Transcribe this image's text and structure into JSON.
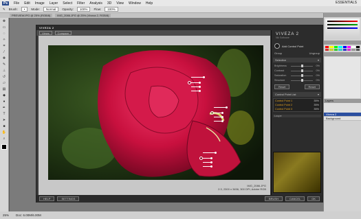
{
  "menubar": {
    "app_badge": "Ps",
    "items": [
      "File",
      "Edit",
      "Image",
      "Layer",
      "Select",
      "Filter",
      "Analysis",
      "3D",
      "View",
      "Window",
      "Help"
    ],
    "workspace": "ESSENTIALS"
  },
  "options_bar": {
    "brush_label": "Brush:",
    "mode_label": "Mode:",
    "mode_value": "Normal",
    "opacity_label": "Opacity:",
    "opacity_value": "100%",
    "flow_label": "Flow:",
    "flow_value": "100%"
  },
  "doc_tabs": [
    "PREVIEW.IPG @ 25% (RGB/8)",
    "IMG_2086.JPG @ 25% (Viveza 2, RGB/8)"
  ],
  "status": {
    "zoom": "25%",
    "doc": "Doc: 6.00M/6.00M"
  },
  "panels": {
    "layers_title": "Layers",
    "layers": [
      "Viveza 2",
      "Background"
    ]
  },
  "viveza": {
    "title_badge": "VIVEZA 2",
    "toolbar": {
      "view_button": "Views",
      "compare_button": "Compare"
    },
    "logo": "VIVEZA 2",
    "logo_sub": "Nik Software",
    "add_control_point": "Add Control Point",
    "group": "Group",
    "ungroup": "Ungroup",
    "selective_head": "Selective",
    "sliders": [
      {
        "label": "Brightness",
        "value": "0%",
        "pos": 0.5
      },
      {
        "label": "Contrast",
        "value": "0%",
        "pos": 0.5
      },
      {
        "label": "Saturation",
        "value": "0%",
        "pos": 0.5
      },
      {
        "label": "Structure",
        "value": "0%",
        "pos": 0.5
      }
    ],
    "reset_label": "Reset",
    "control_points_head": "Control Point List",
    "control_points": [
      {
        "name": "Control Point 1",
        "pct": "35%"
      },
      {
        "name": "Control Point 2",
        "pct": "35%"
      },
      {
        "name": "Control Point 3",
        "pct": "35%"
      }
    ],
    "loupe_head": "Loupe",
    "photo_caption_line1": "IMG_2086.JPG",
    "photo_caption_line2": "2:3, 2300 x 3456, 300 DPI, Adobe RGB",
    "bottom": {
      "help": "HELP",
      "settings": "SETTINGS",
      "brush": "BRUSH",
      "cancel": "CANCEL",
      "ok": "OK"
    }
  }
}
